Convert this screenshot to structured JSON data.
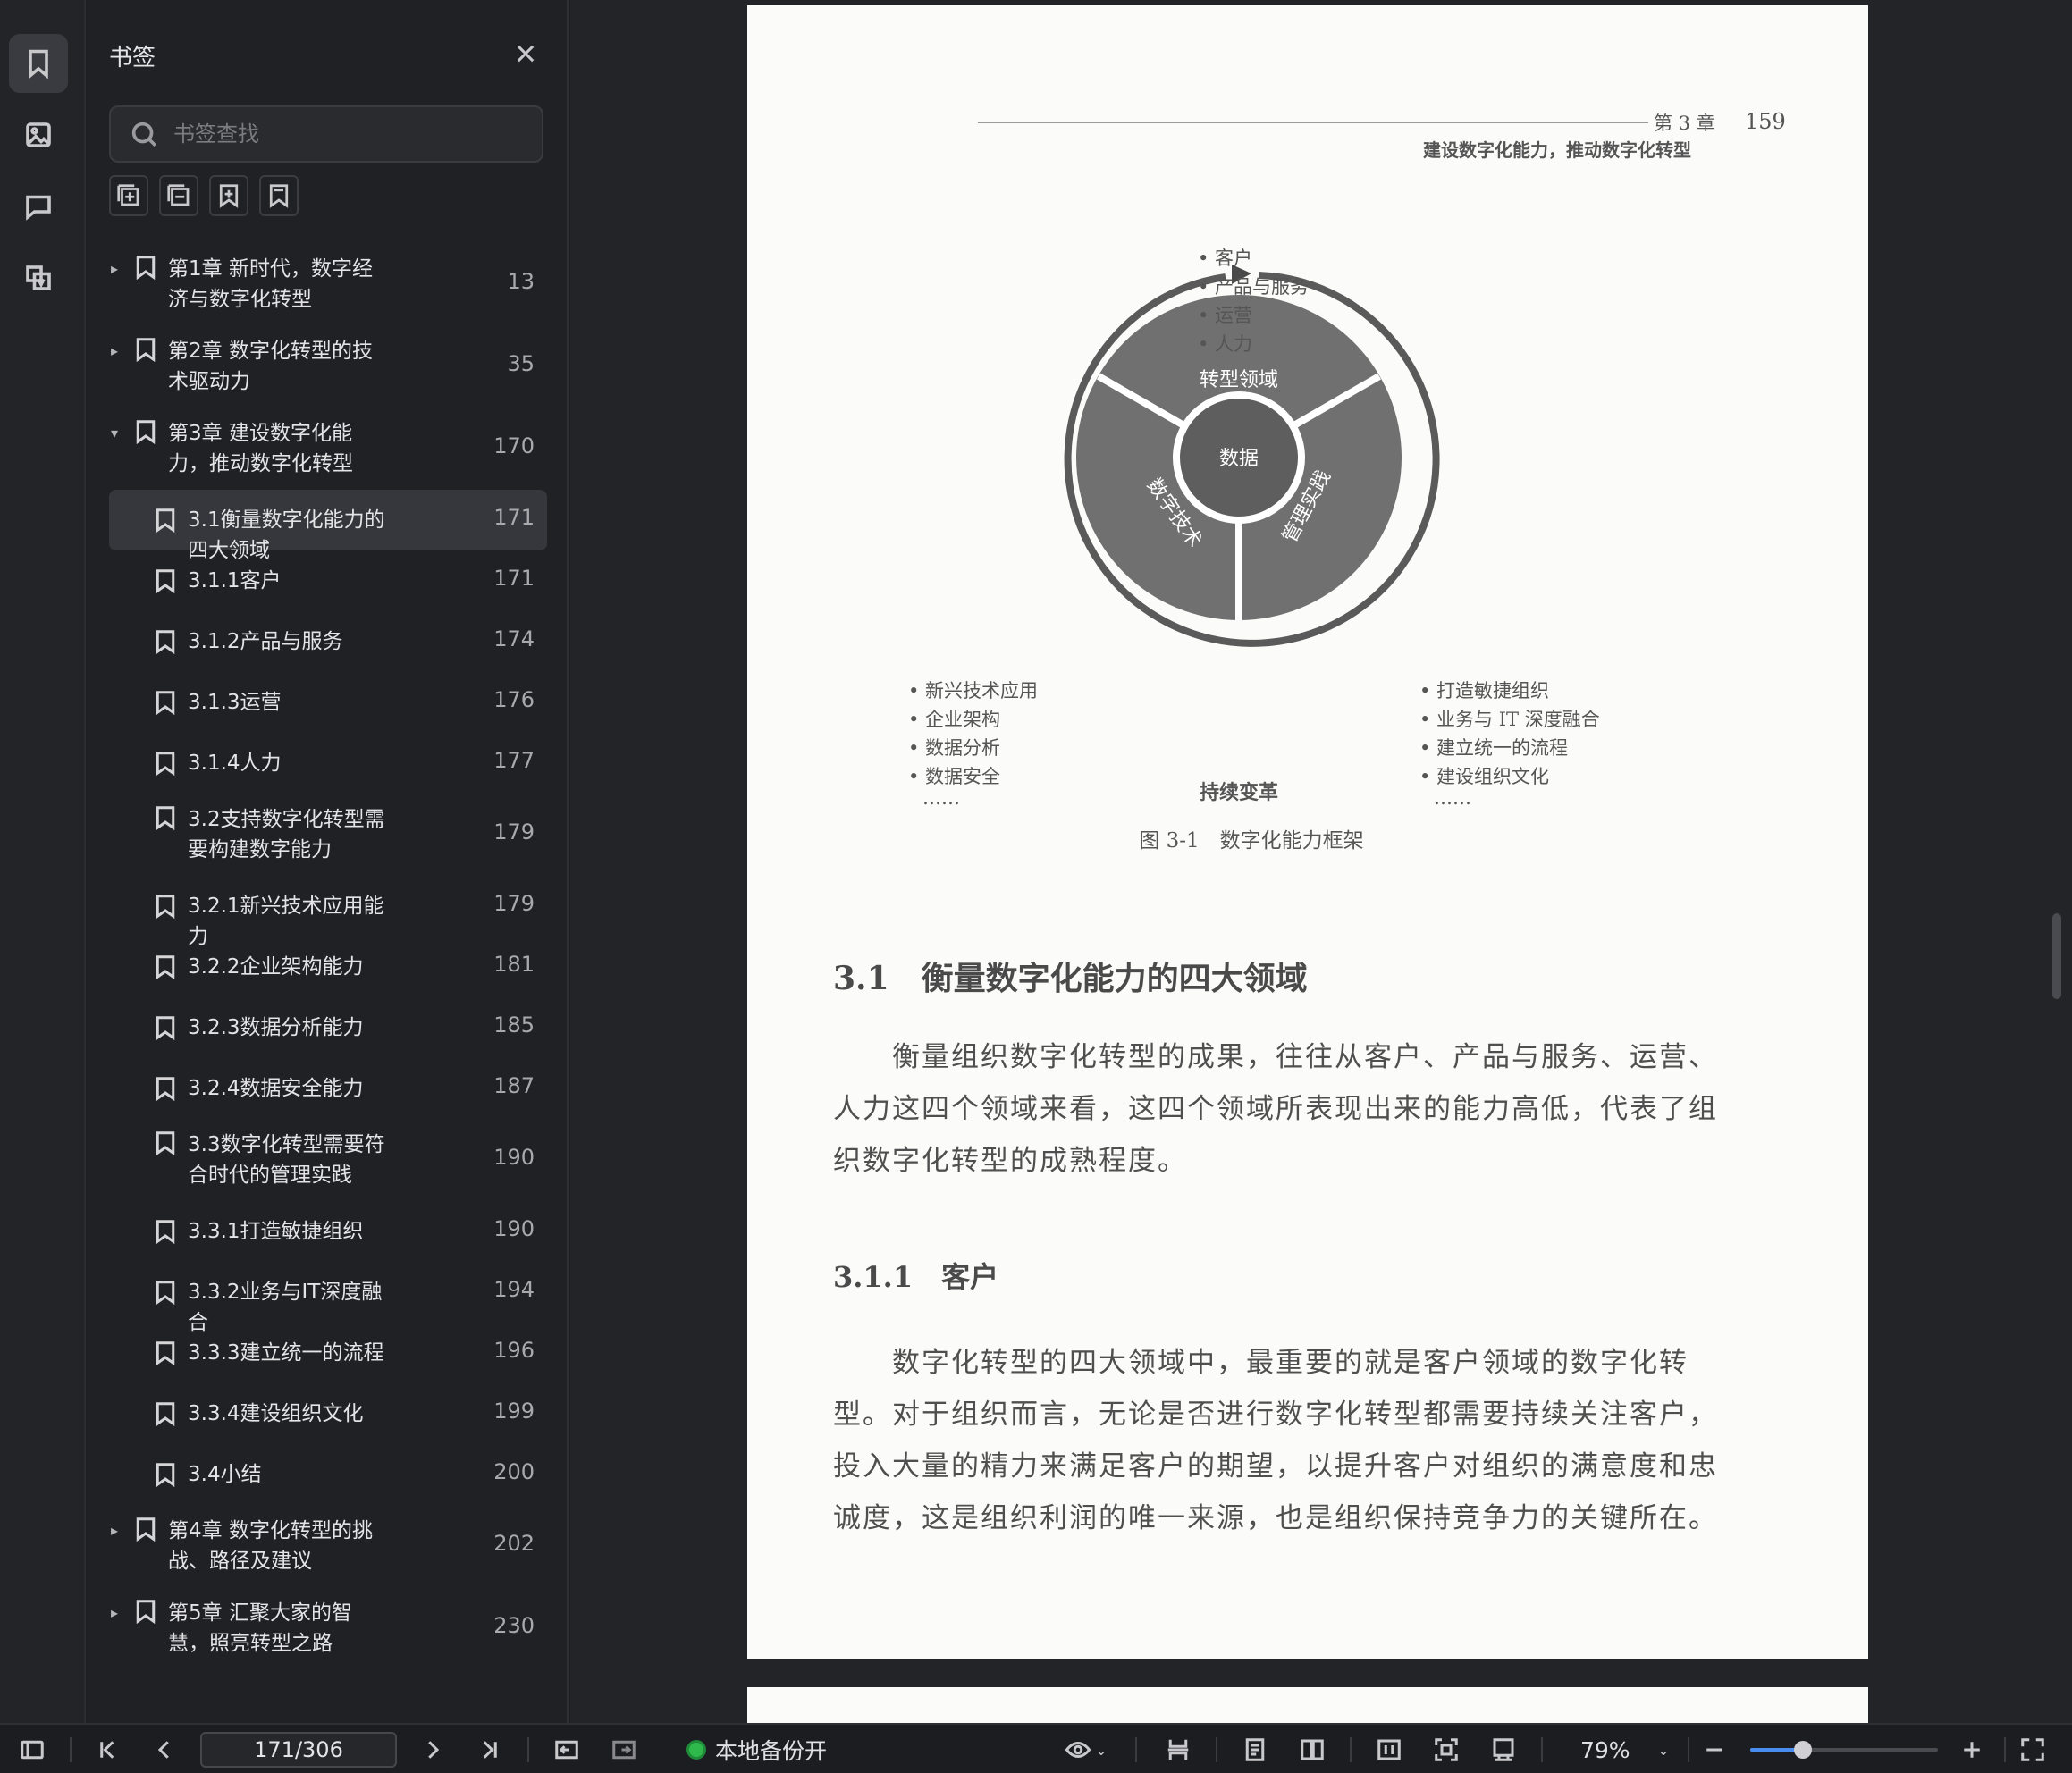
{
  "panel": {
    "title": "书签",
    "search_placeholder": "书签查找"
  },
  "bookmarks": [
    {
      "label": "第1章  新时代，数字经济与数字化转型",
      "page": "13",
      "level": 0,
      "expand": "collapsed"
    },
    {
      "label": "第2章  数字化转型的技术驱动力",
      "page": "35",
      "level": 0,
      "expand": "collapsed"
    },
    {
      "label": "第3章  建设数字化能力，推动数字化转型",
      "page": "170",
      "level": 0,
      "expand": "expanded"
    },
    {
      "label": "3.1衡量数字化能力的四大领域",
      "page": "171",
      "level": 1,
      "selected": true
    },
    {
      "label": "3.1.1客户",
      "page": "171",
      "level": 1
    },
    {
      "label": "3.1.2产品与服务",
      "page": "174",
      "level": 1
    },
    {
      "label": "3.1.3运营",
      "page": "176",
      "level": 1
    },
    {
      "label": "3.1.4人力",
      "page": "177",
      "level": 1
    },
    {
      "label": "3.2支持数字化转型需要构建数字能力",
      "page": "179",
      "level": 1
    },
    {
      "label": "3.2.1新兴技术应用能力",
      "page": "179",
      "level": 1
    },
    {
      "label": "3.2.2企业架构能力",
      "page": "181",
      "level": 1
    },
    {
      "label": "3.2.3数据分析能力",
      "page": "185",
      "level": 1
    },
    {
      "label": "3.2.4数据安全能力",
      "page": "187",
      "level": 1
    },
    {
      "label": "3.3数字化转型需要符合时代的管理实践",
      "page": "190",
      "level": 1
    },
    {
      "label": "3.3.1打造敏捷组织",
      "page": "190",
      "level": 1
    },
    {
      "label": "3.3.2业务与IT深度融合",
      "page": "194",
      "level": 1
    },
    {
      "label": "3.3.3建立统一的流程",
      "page": "196",
      "level": 1
    },
    {
      "label": "3.3.4建设组织文化",
      "page": "199",
      "level": 1
    },
    {
      "label": "3.4小结",
      "page": "200",
      "level": 1
    },
    {
      "label": "第4章  数字化转型的挑战、路径及建议",
      "page": "202",
      "level": 0,
      "expand": "collapsed"
    },
    {
      "label": "第5章  汇聚大家的智慧，照亮转型之路",
      "page": "230",
      "level": 0,
      "expand": "collapsed"
    }
  ],
  "document": {
    "header_chapter": "第 3 章",
    "header_page": "159",
    "header_subtitle": "建设数字化能力，推动数字化转型",
    "figure": {
      "top_list": [
        "• 客户",
        "• 产品与服务",
        "• 运营",
        "• 人力"
      ],
      "left_list": [
        "• 新兴技术应用",
        "• 企业架构",
        "• 数据分析",
        "• 数据安全",
        "……"
      ],
      "right_list": [
        "• 打造敏捷组织",
        "• 业务与 IT 深度融合",
        "• 建立统一的流程",
        "• 建设组织文化",
        "……"
      ],
      "center": "数据",
      "segment_top": "转型领域",
      "segment_left": "数字技术",
      "segment_right": "管理实践",
      "bottom_label": "持续变革",
      "caption": "图 3-1　数字化能力框架"
    },
    "h2": "3.1　衡量数字化能力的四大领域",
    "p1": [
      "衡量组织数字化转型的成果，往往从客户、产品与服务、运营、",
      "人力这四个领域来看，这四个领域所表现出来的能力高低，代表了组",
      "织数字化转型的成熟程度。"
    ],
    "h3": "3.1.1　客户",
    "p2": [
      "数字化转型的四大领域中，最重要的就是客户领域的数字化转",
      "型。对于组织而言，无论是否进行数字化转型都需要持续关注客户，",
      "投入大量的精力来满足客户的期望，以提升客户对组织的满意度和忠",
      "诚度，这是组织利润的唯一来源，也是组织保持竞争力的关键所在。"
    ]
  },
  "statusbar": {
    "page_indicator": "171/306",
    "backup_label": "本地备份开",
    "zoom": "79%",
    "zoom_level_percent": 79
  }
}
